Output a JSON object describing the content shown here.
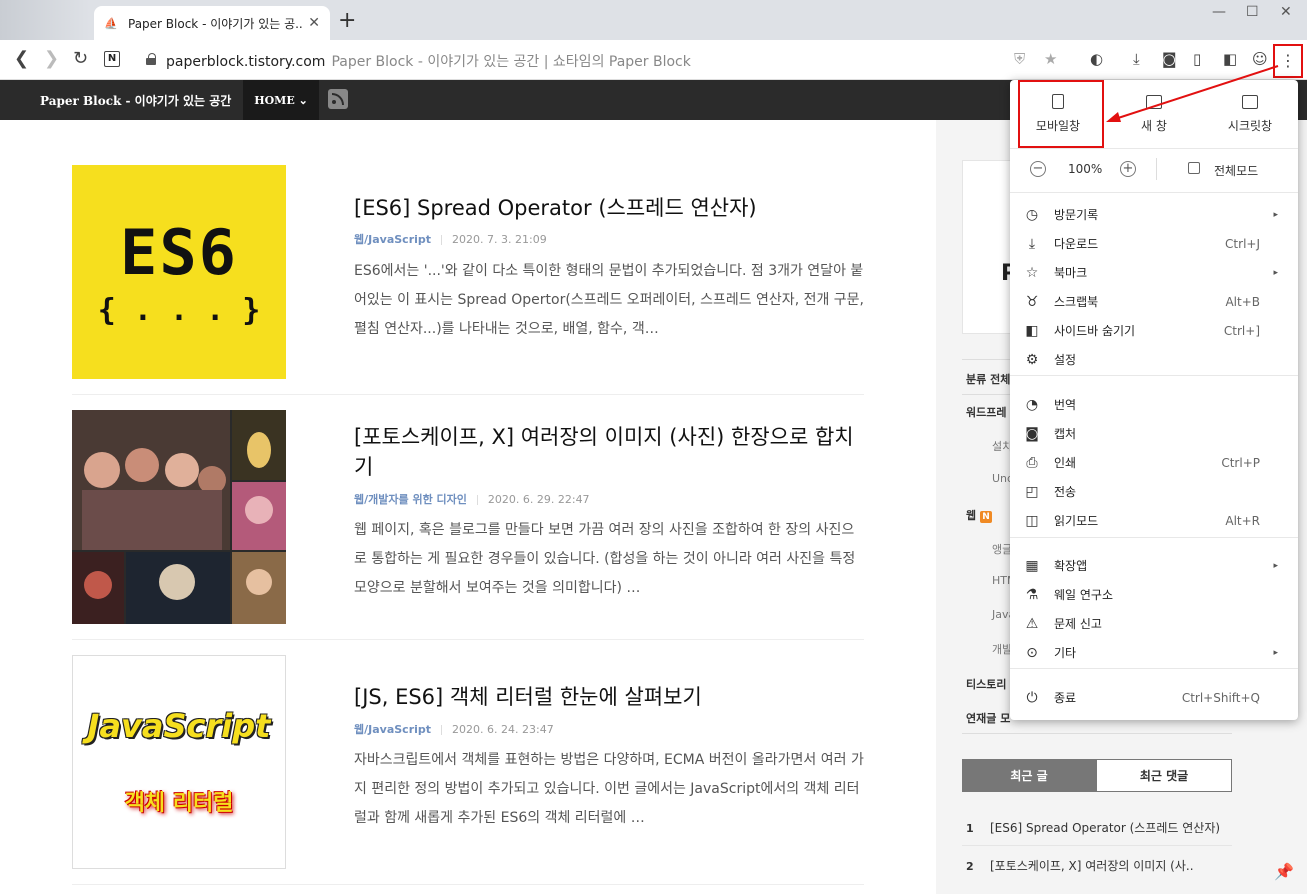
{
  "browser": {
    "tab_title": "Paper Block - 이야기가 있는 공...",
    "url": "paperblock.tistory.com",
    "page_title": "Paper Block - 이야기가 있는 공간 | 쇼타임의 Paper Block"
  },
  "blog": {
    "title": "Paper Block - 이야기가 있는 공간",
    "home_label": "HOME"
  },
  "posts": [
    {
      "title": "[ES6] Spread Operator (스프레드 연산자)",
      "category": "웹/JavaScript",
      "date": "2020. 7. 3. 21:09",
      "excerpt": "ES6에서는 '...'와 같이 다소 특이한 형태의 문법이 추가되었습니다. 점 3개가 연달아 붙어있는 이 표시는 Spread Opertor(스프레드 오퍼레이터, 스프레드 연산자, 전개 구문, 펼침 연산자...)를 나타내는 것으로, 배열, 함수, 객…",
      "thumb_big": "ES6",
      "thumb_small": "{ . . . }"
    },
    {
      "title": "[포토스케이프, X] 여러장의 이미지 (사진) 한장으로 합치기",
      "category": "웹/개발자를 위한 디자인",
      "date": "2020. 6. 29. 22:47",
      "excerpt": "웹 페이지, 혹은 블로그를 만들다 보면 가끔 여러 장의 사진을 조합하여 한 장의 사진으로 통합하는 게 필요한 경우들이 있습니다. (합성을 하는 것이 아니라 여러 사진을 특정 모양으로 분할해서 보여주는 것을 의미합니다) …"
    },
    {
      "title": "[JS, ES6] 객체 리터럴 한눈에 살펴보기",
      "category": "웹/JavaScript",
      "date": "2020. 6. 24. 23:47",
      "excerpt": "자바스크립트에서 객체를 표현하는 방법은 다양하며, ECMA 버전이 올라가면서 여러 가지 편리한 정의 방법이 추가되고 있습니다. 이번 글에서는 JavaScript에서의 객체 리터럴과 함께 새롭게 추가된 ES6의 객체 리터럴에 …",
      "thumb_big": "JavaScript",
      "thumb_small": "객체 리터럴"
    }
  ],
  "sidebar": {
    "categories": [
      "분류 전체",
      "워드프레",
      "웹",
      "티스토리",
      "연재글 모"
    ],
    "subs": [
      "설치",
      "Und",
      "앵글",
      "HTM",
      "Java",
      "개발"
    ],
    "tabs": [
      "최근 글",
      "최근 댓글"
    ],
    "recent": [
      {
        "num": "1",
        "title": "[ES6] Spread Operator (스프레드 연산자)"
      },
      {
        "num": "2",
        "title": "[포토스케이프, X] 여러장의 이미지 (사.."
      }
    ]
  },
  "menu": {
    "top": [
      "모바일창",
      "새 창",
      "시크릿창"
    ],
    "zoom": "100%",
    "fullscreen": "전체모드",
    "items": [
      {
        "icon": "◷",
        "label": "방문기록",
        "shortcut": "",
        "arrow": "▸"
      },
      {
        "icon": "⤓",
        "label": "다운로드",
        "shortcut": "Ctrl+J",
        "arrow": ""
      },
      {
        "icon": "☆",
        "label": "북마크",
        "shortcut": "",
        "arrow": "▸"
      },
      {
        "icon": "♉",
        "label": "스크랩북",
        "shortcut": "Alt+B",
        "arrow": ""
      },
      {
        "icon": "◧",
        "label": "사이드바 숨기기",
        "shortcut": "Ctrl+]",
        "arrow": ""
      },
      {
        "icon": "⚙",
        "label": "설정",
        "shortcut": "",
        "arrow": ""
      },
      {
        "icon": "◔",
        "label": "번역",
        "shortcut": "",
        "arrow": ""
      },
      {
        "icon": "◙",
        "label": "캡처",
        "shortcut": "",
        "arrow": ""
      },
      {
        "icon": "⎙",
        "label": "인쇄",
        "shortcut": "Ctrl+P",
        "arrow": ""
      },
      {
        "icon": "◰",
        "label": "전송",
        "shortcut": "",
        "arrow": ""
      },
      {
        "icon": "◫",
        "label": "읽기모드",
        "shortcut": "Alt+R",
        "arrow": ""
      },
      {
        "icon": "▦",
        "label": "확장앱",
        "shortcut": "",
        "arrow": "▸"
      },
      {
        "icon": "⚗",
        "label": "웨일 연구소",
        "shortcut": "",
        "arrow": ""
      },
      {
        "icon": "⚠",
        "label": "문제 신고",
        "shortcut": "",
        "arrow": ""
      },
      {
        "icon": "⊙",
        "label": "기타",
        "shortcut": "",
        "arrow": "▸"
      },
      {
        "icon": "⏻",
        "label": "종료",
        "shortcut": "Ctrl+Shift+Q",
        "arrow": ""
      }
    ]
  }
}
